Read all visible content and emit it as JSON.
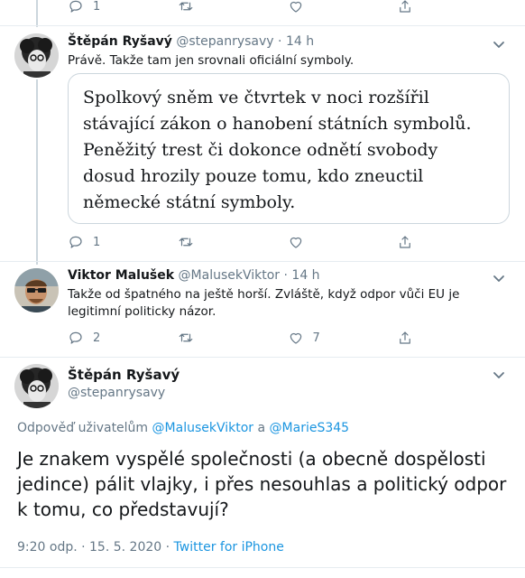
{
  "top_actions": {
    "reply_count": "1",
    "retweet_count": "",
    "like_count": ""
  },
  "tweet1": {
    "name": "Štěpán Ryšavý",
    "handle": "@stepanrysavy",
    "separator": "·",
    "time": "14 h",
    "text": "Právě. Takže tam jen srovnali oficiální symboly.",
    "quote": "Spolkový sněm ve čtvrtek v noci rozšířil stávající zákon o hanobení státních symbolů. Peněžitý trest či dokonce odnětí svobody dosud hrozily pouze tomu, kdo zneuctil německé státní symboly.",
    "reply_count": "1",
    "retweet_count": "",
    "like_count": ""
  },
  "tweet2": {
    "name": "Viktor Malušek",
    "handle": "@MalusekViktor",
    "separator": "·",
    "time": "14 h",
    "text": "Takže od špatného na ještě horší. Zvláště, když odpor vůči EU je legitimní politicky názor.",
    "reply_count": "2",
    "retweet_count": "",
    "like_count": "7"
  },
  "main_tweet": {
    "name": "Štěpán Ryšavý",
    "handle": "@stepanrysavy",
    "reply_prefix": "Odpověď uživatelům ",
    "reply_user1": "@MalusekViktor",
    "reply_and": " a ",
    "reply_user2": "@MarieS345",
    "text": "Je znakem vyspělé společnosti (a obecně dospělosti jedince) pálit vlajky, i přes nesouhlas a politický odpor k tomu, co představují?",
    "timestamp": "9:20 odp. · 15. 5. 2020 · ",
    "source": "Twitter for iPhone"
  },
  "icons": [
    "reply-icon",
    "retweet-icon",
    "like-icon",
    "share-icon",
    "chevron-down-icon"
  ],
  "colors": {
    "link": "#1b95e0",
    "secondary_text": "#657786",
    "border": "#ccd6dd"
  }
}
